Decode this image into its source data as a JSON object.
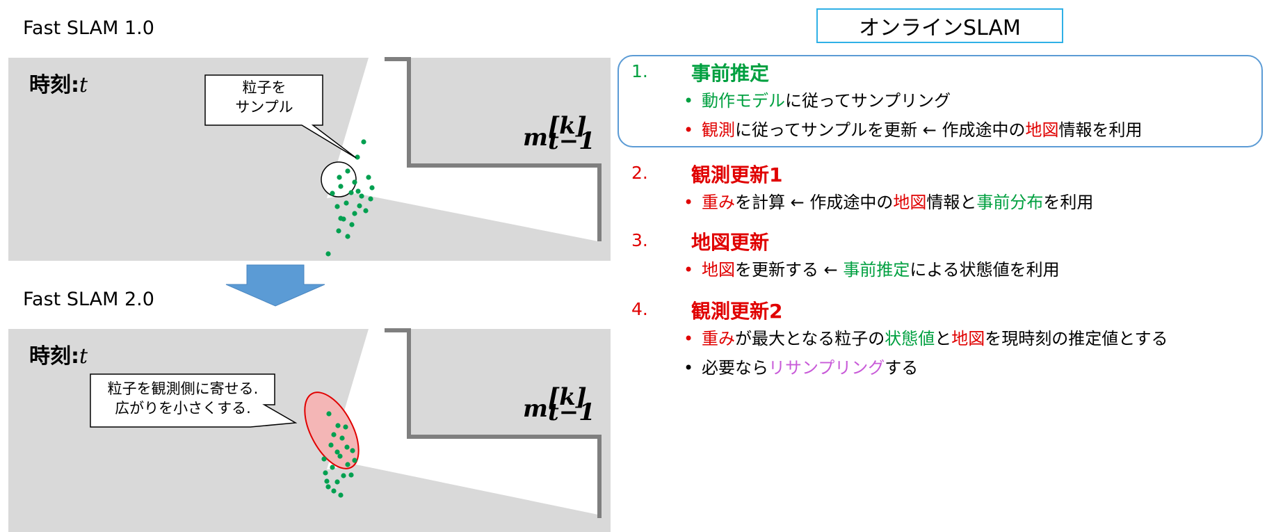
{
  "left": {
    "panel1_heading": "Fast SLAM 1.0",
    "panel2_heading": "Fast SLAM 2.0",
    "time_label": "時刻:",
    "time_var": "t",
    "map_label": {
      "base": "m",
      "sup": "[k]",
      "sub": "t−1"
    },
    "callout1": [
      "粒子を",
      "サンプル"
    ],
    "callout2": [
      "粒子を観測側に寄せる.",
      "広がりを小さくする."
    ]
  },
  "right": {
    "title": "オンラインSLAM",
    "steps": [
      {
        "number": "1.",
        "title": "事前推定",
        "bullets": [
          [
            {
              "t": "動作モデル",
              "c": "green"
            },
            {
              "t": "に従ってサンプリング",
              "c": "black"
            }
          ],
          [
            {
              "t": "観測",
              "c": "red"
            },
            {
              "t": "に従ってサンプルを更新 ← 作成途中の",
              "c": "black"
            },
            {
              "t": "地図",
              "c": "red"
            },
            {
              "t": "情報を利用",
              "c": "black"
            }
          ]
        ]
      },
      {
        "number": "2.",
        "title": "観測更新1",
        "bullets": [
          [
            {
              "t": "重み",
              "c": "red"
            },
            {
              "t": "を計算 ← 作成途中の",
              "c": "black"
            },
            {
              "t": "地図",
              "c": "red"
            },
            {
              "t": "情報と",
              "c": "black"
            },
            {
              "t": "事前分布",
              "c": "green"
            },
            {
              "t": "を利用",
              "c": "black"
            }
          ]
        ]
      },
      {
        "number": "3.",
        "title": "地図更新",
        "bullets": [
          [
            {
              "t": "地図",
              "c": "red"
            },
            {
              "t": "を更新する ← ",
              "c": "black"
            },
            {
              "t": "事前推定",
              "c": "green"
            },
            {
              "t": "による状態値を利用",
              "c": "black"
            }
          ]
        ]
      },
      {
        "number": "4.",
        "title": "観測更新2",
        "bullets": [
          [
            {
              "t": "重み",
              "c": "red"
            },
            {
              "t": "が最大となる粒子の",
              "c": "black"
            },
            {
              "t": "状態値",
              "c": "green"
            },
            {
              "t": "と",
              "c": "black"
            },
            {
              "t": "地図",
              "c": "red"
            },
            {
              "t": "を現時刻の推定値とする",
              "c": "black"
            }
          ],
          [
            {
              "t": "必要なら",
              "c": "black"
            },
            {
              "t": "リサンプリング",
              "c": "purple"
            },
            {
              "t": "する",
              "c": "black"
            }
          ]
        ]
      }
    ]
  },
  "colors": {
    "green": "#00a040",
    "red": "#e00000",
    "purple": "#c85ad8",
    "black": "#000000",
    "title_border": "#2fb0e6",
    "step1_border": "#5b9bd5",
    "panel_gray": "#d9d9d9",
    "wall_gray": "#7f7f7f",
    "arrow_blue": "#5b9bd5",
    "ellipse_fill": "#f4b6b6"
  }
}
